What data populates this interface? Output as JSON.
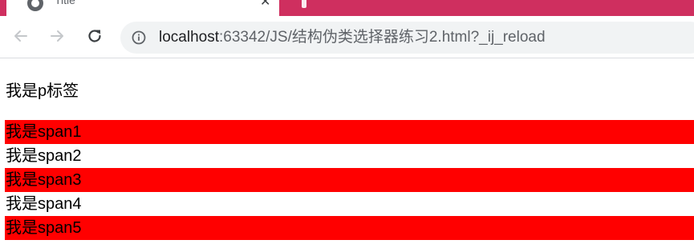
{
  "browser": {
    "tab_title": "Title",
    "tab_close": "✕",
    "url_host": "localhost",
    "url_rest": ":63342/JS/结构伪类选择器练习2.html?_ij_reload",
    "colors": {
      "tabstrip": "#cf2f5f",
      "omnibox": "#f1f3f4",
      "icon": "#5f6368"
    }
  },
  "page": {
    "paragraph": "我是p标签",
    "spans": [
      {
        "text": "我是span1",
        "highlight": true
      },
      {
        "text": "我是span2",
        "highlight": false
      },
      {
        "text": "我是span3",
        "highlight": true
      },
      {
        "text": "我是span4",
        "highlight": false
      },
      {
        "text": "我是span5",
        "highlight": true
      }
    ],
    "highlight_color": "#ff0000"
  }
}
